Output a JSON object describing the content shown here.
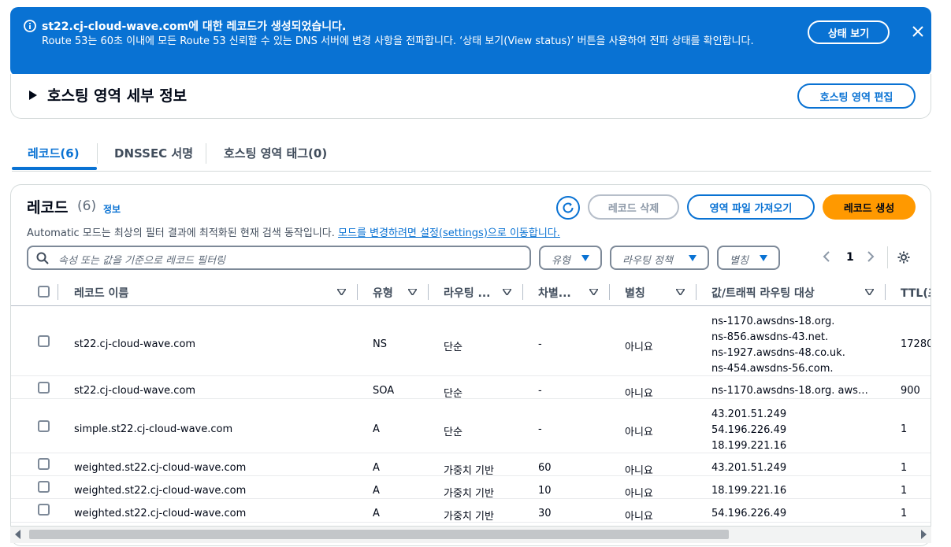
{
  "flash": {
    "title": "st22.cj-cloud-wave.com에 대한 레코드가 생성되었습니다.",
    "body": "Route 53는 60초 이내에 모든 Route 53 신뢰할 수 있는 DNS 서버에 변경 사항을 전파합니다. ‘상태 보기(View status)’ 버튼을 사용하여 전파 상태를 확인합니다.",
    "status_button": "상태 보기",
    "color": "#0972d3"
  },
  "details": {
    "label": "호스팅 영역 세부 정보",
    "edit_button": "호스팅 영역 편집"
  },
  "tabs": [
    {
      "label": "레코드(6)",
      "active": true
    },
    {
      "label": "DNSSEC 서명",
      "active": false
    },
    {
      "label": "호스팅 영역 태그(0)",
      "active": false
    }
  ],
  "records": {
    "heading": "레코드",
    "count": "(6)",
    "info_link": "정보",
    "desc_prefix": "Automatic 모드는 최상의 필터 결과에 최적화된 현재 검색 동작입니다.",
    "desc_link": "모드를 변경하려면 설정(settings)으로 이동합니다.",
    "buttons": {
      "delete": "레코드 삭제",
      "import": "영역 파일 가져오기",
      "create": "레코드 생성"
    },
    "search_placeholder": "속성 또는 값을 기준으로 레코드 필터링",
    "filters": {
      "type": "유형",
      "routing": "라우팅 정책",
      "alias": "별칭"
    },
    "page": "1",
    "columns": [
      "레코드 이름",
      "유형",
      "라우팅 ...",
      "차별...",
      "별칭",
      "값/트래픽 라우팅 대상",
      "TTL(초"
    ],
    "rows": [
      {
        "name": "st22.cj-cloud-wave.com",
        "type": "NS",
        "routing": "단순",
        "diff": "-",
        "alias": "아니요",
        "values": [
          "ns-1170.awsdns-18.org.",
          "ns-856.awsdns-43.net.",
          "ns-1927.awsdns-48.co.uk.",
          "ns-454.awsdns-56.com."
        ],
        "ttl": "17280"
      },
      {
        "name": "st22.cj-cloud-wave.com",
        "type": "SOA",
        "routing": "단순",
        "diff": "-",
        "alias": "아니요",
        "values": [
          "ns-1170.awsdns-18.org. aws…"
        ],
        "ttl": "900"
      },
      {
        "name": "simple.st22.cj-cloud-wave.com",
        "type": "A",
        "routing": "단순",
        "diff": "-",
        "alias": "아니요",
        "values": [
          "43.201.51.249",
          "54.196.226.49",
          "18.199.221.16"
        ],
        "ttl": "1"
      },
      {
        "name": "weighted.st22.cj-cloud-wave.com",
        "type": "A",
        "routing": "가중치 기반",
        "diff": "60",
        "alias": "아니요",
        "values": [
          "43.201.51.249"
        ],
        "ttl": "1"
      },
      {
        "name": "weighted.st22.cj-cloud-wave.com",
        "type": "A",
        "routing": "가중치 기반",
        "diff": "10",
        "alias": "아니요",
        "values": [
          "18.199.221.16"
        ],
        "ttl": "1"
      },
      {
        "name": "weighted.st22.cj-cloud-wave.com",
        "type": "A",
        "routing": "가중치 기반",
        "diff": "30",
        "alias": "아니요",
        "values": [
          "54.196.226.49"
        ],
        "ttl": "1"
      }
    ]
  }
}
